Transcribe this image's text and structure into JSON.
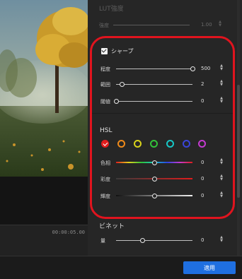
{
  "preview": {
    "time": "00:00:05.00"
  },
  "panel": {
    "lut": {
      "title": "LUT強度",
      "row_label": "強度",
      "value": "1.00"
    },
    "sharpen": {
      "label": "シャープ",
      "checked": true,
      "rows": [
        {
          "label": "程度",
          "value": "500",
          "level": 1.0
        },
        {
          "label": "範囲",
          "value": "2",
          "level": 0.08
        },
        {
          "label": "閾値",
          "value": "0",
          "level": 0.0
        }
      ]
    },
    "hsl": {
      "title": "HSL",
      "swatch_colors": [
        "#e01c1c",
        "#ef8a1a",
        "#d8d21b",
        "#33c23a",
        "#17c7c7",
        "#3a45d8",
        "#c43ad0"
      ],
      "rows": [
        {
          "label": "色相",
          "value": "0",
          "level": 0.5
        },
        {
          "label": "彩度",
          "value": "0",
          "level": 0.5
        },
        {
          "label": "輝度",
          "value": "0",
          "level": 0.5
        }
      ]
    },
    "vignette": {
      "title": "ビネット",
      "row_label": "量",
      "value": "0",
      "level": 0.35
    }
  },
  "footer": {
    "apply_label": "適用"
  },
  "accent_colors": {
    "highlight": "#e0141e",
    "primary": "#1f6fe0"
  }
}
